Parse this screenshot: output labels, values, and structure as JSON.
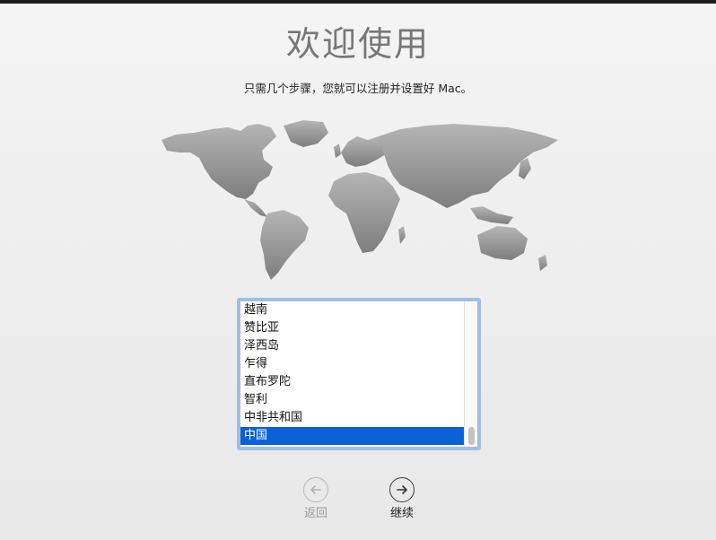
{
  "header": {
    "title": "欢迎使用",
    "subtitle": "只需几个步骤，您就可以注册并设置好 Mac。"
  },
  "country_list": {
    "items": [
      "越南",
      "赞比亚",
      "泽西岛",
      "乍得",
      "直布罗陀",
      "智利",
      "中非共和国",
      "中国"
    ],
    "selected": "中国"
  },
  "navigation": {
    "back_label": "返回",
    "next_label": "继续"
  },
  "colors": {
    "selection": "#0b62d6",
    "focus_ring": "#9cbfe8",
    "map_land": "#8f8f8f"
  },
  "icons": {
    "map": "world-map-icon",
    "back": "arrow-left-circle-icon",
    "next": "arrow-right-circle-icon"
  }
}
